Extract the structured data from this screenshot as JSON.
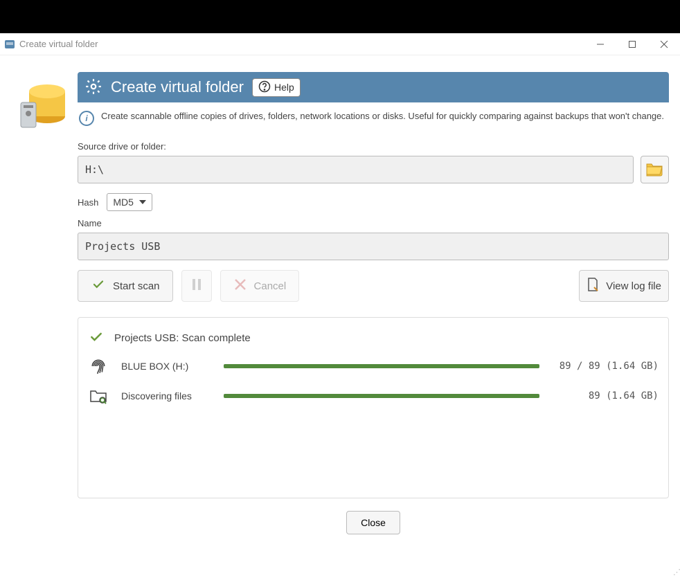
{
  "window": {
    "title": "Create virtual folder"
  },
  "header": {
    "title": "Create virtual folder",
    "help_label": "Help"
  },
  "info": {
    "text": "Create scannable offline copies of drives, folders, network locations or disks. Useful for quickly comparing against backups that won't change."
  },
  "source": {
    "label": "Source drive or folder:",
    "value": "H:\\"
  },
  "hash": {
    "label": "Hash",
    "selected": "MD5"
  },
  "name": {
    "label": "Name",
    "value": "Projects USB"
  },
  "buttons": {
    "start_scan": "Start scan",
    "cancel": "Cancel",
    "view_log": "View log file",
    "close": "Close"
  },
  "status": {
    "text": "Projects USB: Scan complete"
  },
  "tasks": [
    {
      "label": "BLUE BOX (H:)",
      "progress_pct": 100,
      "stats": "89 / 89 (1.64 GB)"
    },
    {
      "label": "Discovering files",
      "progress_pct": 100,
      "stats": "89 (1.64 GB)"
    }
  ],
  "colors": {
    "header_bg": "#5786ad",
    "progress": "#528a3b",
    "check": "#6a9a3a"
  }
}
